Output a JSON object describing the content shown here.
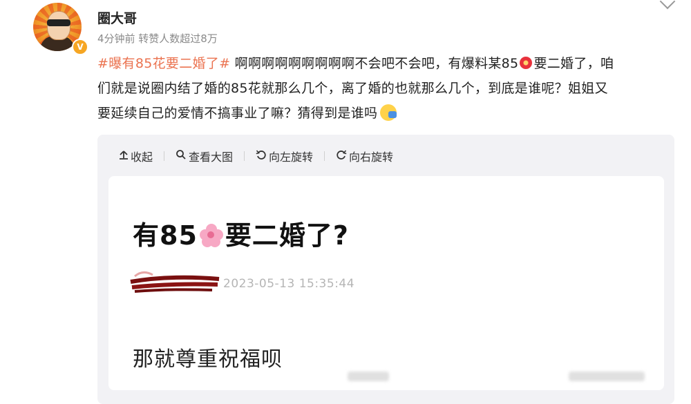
{
  "user": {
    "name": "圈大哥",
    "badge": "V",
    "meta": "4分钟前 转赞人数超过8万"
  },
  "post": {
    "hashtag": "#曝有85花要二婚了#",
    "text_line1": " 啊啊啊啊啊啊啊啊啊不会吧不会吧，有爆料某85",
    "text_line1b": "要二婚了，咱",
    "text_line2": "们就是说圈内结了婚的85花就那么几个，离了婚的也就那么几个，到底是谁呢？姐姐又",
    "text_line3": "要延续自己的爱情不搞事业了嘛？猜得到是谁吗"
  },
  "toolbar": {
    "collapse_label": "收起",
    "view_large_label": "查看大图",
    "rotate_left_label": "向左旋转",
    "rotate_right_label": "向右旋转"
  },
  "image_card": {
    "title_prefix": "有85",
    "title_suffix": "要二婚了?",
    "timestamp": "2023-05-13 15:35:44",
    "body": "那就尊重祝福呗"
  },
  "icons": [
    "chevron-down-icon",
    "verified-badge-icon",
    "flower-emoji-icon",
    "wave-emoji-icon",
    "collapse-icon",
    "search-icon",
    "rotate-left-icon",
    "rotate-right-icon"
  ],
  "colors": {
    "hashtag": "#eb7350",
    "meta": "#8a8a8a",
    "panel_bg": "#f2f2f5"
  }
}
